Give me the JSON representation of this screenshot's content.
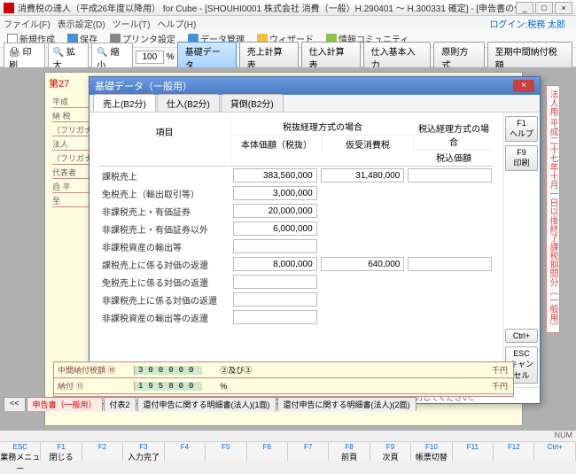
{
  "window": {
    "title": "消費税の達人（平成26年度以降用） for Cube - [SHOUHI0001 株式会社 消費（一般）H.290401 ～ H.300331 確定] - [申告書の作成]",
    "min": "_",
    "max": "□",
    "close": "×"
  },
  "menu": {
    "file": "ファイル(F)",
    "display": "表示設定(D)",
    "tool": "ツール(T)",
    "help": "ヘルプ(H)",
    "login": "ログイン:税務 太郎"
  },
  "tb1": {
    "new": "新規作成",
    "save": "保存",
    "prset": "プリンタ設定",
    "data": "データ管理",
    "wiz": "ウィザード",
    "comm": "情報コミュニティ"
  },
  "tb2": {
    "print": "印刷",
    "zin": "拡大",
    "zout": "縮小",
    "zoom": "100",
    "pct": "%",
    "m1": "基礎データ",
    "m2": "売上計算表",
    "m3": "仕入計算表",
    "m4": "仕入基本入力",
    "m5": "原則方式",
    "m6": "至期中間納付税額"
  },
  "bgform": {
    "hdr": "第27",
    "l1": "平成",
    "l2": "納 税",
    "l3": "（フリガナ）",
    "l4": "法人",
    "l5": "（フリガナ）",
    "l6": "代表者",
    "l7": "自 平",
    "l8": "至"
  },
  "side": "法人用 平成二十七年十月一日以後終了課税期間分（一般用）",
  "dialog": {
    "title": "基礎データ（一般用）",
    "tabs": {
      "t1": "売上(B2分)",
      "t2": "仕入(B2分)",
      "t3": "貸倒(B2分)"
    },
    "side": {
      "f1": "F1",
      "help": "ヘルプ",
      "f9": "F9",
      "prn": "印刷",
      "ctrl": "Ctrl+",
      "esc": "ESC",
      "cancel": "キャンセル"
    },
    "cols": {
      "item": "項目",
      "g1": "税抜経理方式の場合",
      "c1": "本体価額（税抜）",
      "c2": "仮受消費税",
      "g2": "税込経理方式の場合",
      "c3": "税込価額"
    },
    "rows": [
      {
        "label": "課税売上",
        "v1": "383,560,000",
        "v2": "31,480,000",
        "v3": ""
      },
      {
        "label": "免税売上（輸出取引等）",
        "v1": "3,000,000",
        "v2": null,
        "v3": null
      },
      {
        "label": "非課税売上・有価証券",
        "v1": "20,000,000",
        "v2": null,
        "v3": null
      },
      {
        "label": "非課税売上・有価証券以外",
        "v1": "6,000,000",
        "v2": null,
        "v3": null
      },
      {
        "label": "非課税資産の輸出等",
        "v1": "",
        "v2": null,
        "v3": null
      },
      {
        "label": "課税売上に係る対価の返還",
        "v1": "8,000,000",
        "v2": "640,000",
        "v3": ""
      },
      {
        "label": "免税売上に係る対価の返還",
        "v1": "",
        "v2": null,
        "v3": null
      },
      {
        "label": "非課税売上に係る対価の返還",
        "v1": "",
        "v2": null,
        "v3": null
      },
      {
        "label": "非課税資産の輸出等の返還",
        "v1": "",
        "v2": null,
        "v3": null
      }
    ],
    "note": "(注) 経理方式が混在している場合は、税抜経理方式と税込経理方式のそれぞれに金額を入力してください。"
  },
  "bottom": {
    "r1": {
      "label": "中間納付税額 ⑩",
      "num": "300000",
      "pct": "②及び③",
      "unit": "千円"
    },
    "r2": {
      "label": "納付 ⑪",
      "num": "195800",
      "pct": "%",
      "unit": "千円"
    }
  },
  "sheets": {
    "s0": "<<",
    "s1": "申告書（一般用）",
    "s2": "付表2",
    "s3": "還付申告に関する明細書(法人)(1面)",
    "s4": "還付申告に関する明細書(法人)(2面)"
  },
  "fkeys": [
    {
      "fn": "ESC",
      "lbl": "業務メニュー"
    },
    {
      "fn": "F1",
      "lbl": "閉じる"
    },
    {
      "fn": "F2",
      "lbl": ""
    },
    {
      "fn": "F3",
      "lbl": "入力完了"
    },
    {
      "fn": "F4",
      "lbl": ""
    },
    {
      "fn": "F5",
      "lbl": ""
    },
    {
      "fn": "F6",
      "lbl": ""
    },
    {
      "fn": "F7",
      "lbl": ""
    },
    {
      "fn": "F8",
      "lbl": "前頁"
    },
    {
      "fn": "F9",
      "lbl": "次頁"
    },
    {
      "fn": "F10",
      "lbl": "帳票切替"
    },
    {
      "fn": "F11",
      "lbl": ""
    },
    {
      "fn": "F12",
      "lbl": ""
    },
    {
      "fn": "Ctrl+",
      "lbl": ""
    }
  ],
  "status": "NUM",
  "chart_data": null
}
